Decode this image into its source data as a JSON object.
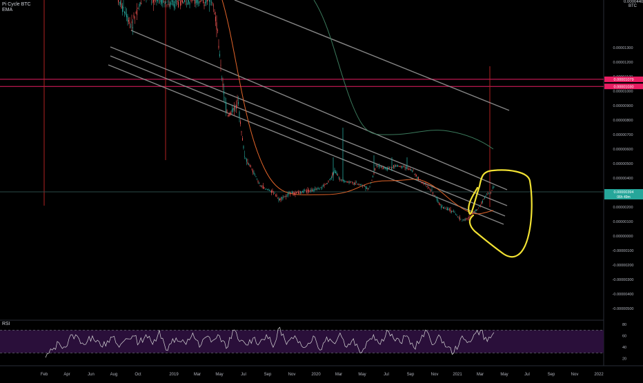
{
  "legend": {
    "title": "Pi Cycle BTC",
    "ema": "EMA"
  },
  "top_right": {
    "first_label": "0.00004400",
    "unit": "BTC"
  },
  "rsi": {
    "title": "RSI",
    "ticks": [
      "80",
      "60",
      "40",
      "20"
    ]
  },
  "colors": {
    "background": "#000000",
    "candle_up": "#26a69a",
    "candle_down": "#ef5350",
    "ema_line": "#e4652a",
    "channel_lines": "#9e9e9e",
    "long_ma": "#3b7a5c",
    "hline": "#e91e63",
    "vertical_event": "#b22222",
    "annotation": "#f2e233",
    "rsi_line": "#d8d8d8",
    "rsi_band": "#2a0f3a",
    "last_price_label": "#26a69a"
  },
  "price_axis": {
    "labels": [
      "0.00001300",
      "0.00001200",
      "0.00001100",
      "0.00001000",
      "0.00000900",
      "0.00000800",
      "0.00000700",
      "0.00000600",
      "0.00000500",
      "0.00000400",
      "0.00000300",
      "0.00000200",
      "0.00000100",
      "0.00000000",
      "-0.00000100",
      "-0.00000200",
      "-0.00000300",
      "-0.00000400",
      "-0.00000500"
    ],
    "hline_labels": [
      "0.00001079",
      "0.00001030"
    ],
    "last_price": "0.00000394",
    "last_price_countdown": "06h 49m"
  },
  "time_axis": {
    "labels": [
      "Feb",
      "Apr",
      "Jun",
      "Aug",
      "Oct",
      "2019",
      "Mar",
      "May",
      "Jul",
      "Sep",
      "Nov",
      "2020",
      "Mar",
      "May",
      "Jul",
      "Sep",
      "Nov",
      "2021",
      "Mar",
      "May",
      "Jul",
      "Sep",
      "Nov",
      "2022"
    ]
  },
  "chart_data": {
    "type": "line",
    "title": "Pi Cycle BTC",
    "series": [
      {
        "name": "EMA"
      }
    ],
    "x": [
      "2018-02",
      "2018-04",
      "2018-06",
      "2018-08",
      "2018-10",
      "2019-01",
      "2019-03",
      "2019-05",
      "2019-07",
      "2019-09",
      "2019-11",
      "2020-01",
      "2020-03",
      "2020-05",
      "2020-07",
      "2020-09",
      "2020-11",
      "2021-01",
      "2021-03"
    ],
    "price_approx": [
      null,
      null,
      null,
      1.45e-05,
      1.3e-05,
      1.4e-05,
      1.25e-05,
      1e-05,
      5e-06,
      3e-06,
      2.7e-06,
      2.8e-06,
      3e-06,
      2.9e-06,
      4.3e-06,
      3.7e-06,
      1.8e-06,
      2.2e-06,
      3.9e-06
    ],
    "ema_approx": [
      null,
      null,
      null,
      null,
      null,
      null,
      null,
      null,
      8e-06,
      4e-06,
      2.9e-06,
      2.8e-06,
      2.9e-06,
      3e-06,
      3.3e-06,
      3.6e-06,
      2.7e-06,
      2e-06,
      3e-06
    ],
    "ylim": [
      -5e-06,
      1.45e-05
    ],
    "horizontal_levels": [
      1.079e-05,
      1.03e-05
    ],
    "indicator": {
      "name": "RSI",
      "ylim": [
        10,
        85
      ],
      "bands": [
        30,
        70
      ],
      "values_approx": [
        22,
        35,
        48,
        40,
        62,
        55,
        45,
        60,
        50,
        42,
        58,
        40,
        55,
        60,
        48,
        62,
        45,
        70,
        35,
        55,
        50,
        45,
        65,
        40,
        58,
        52,
        60,
        38,
        70,
        50,
        44,
        56,
        48,
        62,
        40,
        75,
        45,
        55,
        50,
        42,
        60,
        35,
        58,
        48,
        65,
        40,
        55,
        30,
        50,
        62,
        45,
        70,
        55,
        48,
        60,
        40,
        52,
        68,
        45,
        58,
        40,
        30,
        55,
        48,
        62,
        70,
        50,
        66
      ]
    }
  }
}
